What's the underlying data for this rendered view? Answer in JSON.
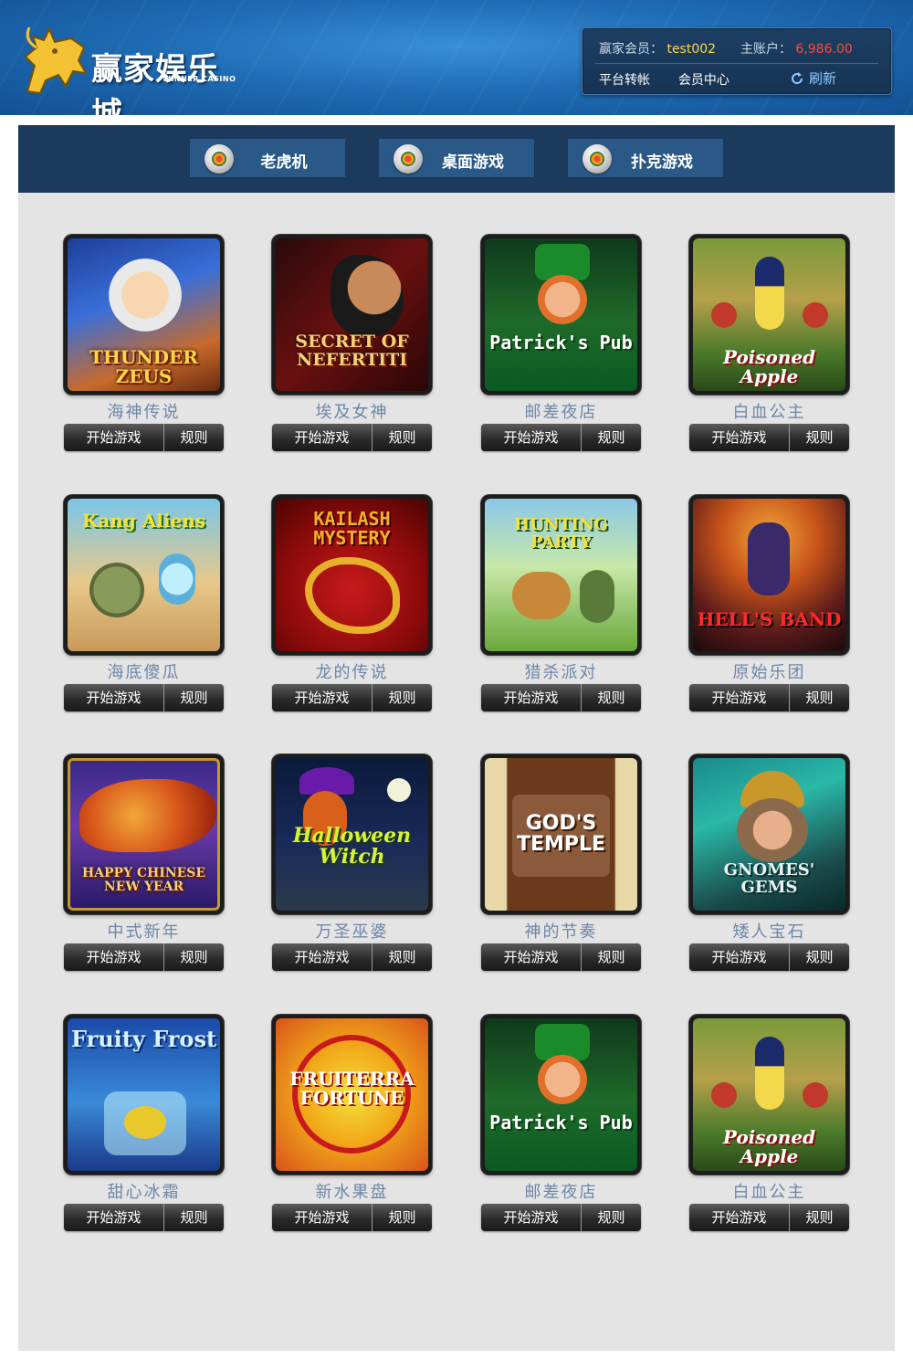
{
  "brand": {
    "name": "赢家娱乐城",
    "subtitle": "WINNER CASINO"
  },
  "account": {
    "member_label": "赢家会员：",
    "member_name": "test002",
    "balance_label": "主账户：",
    "balance": "6,986.00",
    "transfer_label": "平台转帐",
    "center_label": "会员中心",
    "refresh_label": "刷新"
  },
  "tabs": [
    {
      "label": "老虎机",
      "icon": "slot-machine-icon"
    },
    {
      "label": "桌面游戏",
      "icon": "roulette-icon"
    },
    {
      "label": "扑克游戏",
      "icon": "poker-dealer-icon"
    }
  ],
  "buttons": {
    "play": "开始游戏",
    "rules": "规则"
  },
  "games": [
    {
      "name": "海神传说",
      "art_title": "THUNDER ZEUS"
    },
    {
      "name": "埃及女神",
      "art_title": "SECRET OF NEFERTITI"
    },
    {
      "name": "邮差夜店",
      "art_title": "Patrick's Pub"
    },
    {
      "name": "白血公主",
      "art_title": "Poisoned Apple"
    },
    {
      "name": "海底傻瓜",
      "art_title": "Kang Aliens"
    },
    {
      "name": "龙的传说",
      "art_title": "KAILASH MYSTERY"
    },
    {
      "name": "猎杀派对",
      "art_title": "HUNTING PARTY"
    },
    {
      "name": "原始乐团",
      "art_title": "HELL'S BAND"
    },
    {
      "name": "中式新年",
      "art_title": "HAPPY CHINESE NEW YEAR"
    },
    {
      "name": "万圣巫婆",
      "art_title": "Halloween Witch"
    },
    {
      "name": "神的节奏",
      "art_title": "GOD'S TEMPLE"
    },
    {
      "name": "矮人宝石",
      "art_title": "GNOMES' GEMS"
    },
    {
      "name": "甜心冰霜",
      "art_title": "Fruity Frost"
    },
    {
      "name": "新水果盘",
      "art_title": "FRUITERRA FORTUNE"
    },
    {
      "name": "邮差夜店",
      "art_title": "Patrick's Pub"
    },
    {
      "name": "白血公主",
      "art_title": "Poisoned Apple"
    }
  ]
}
